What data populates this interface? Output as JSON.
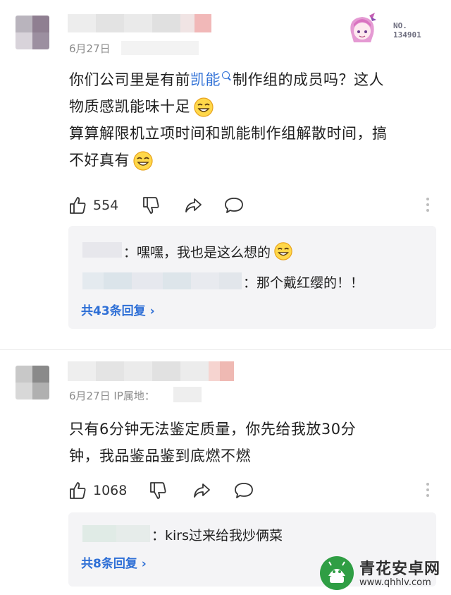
{
  "comments": [
    {
      "date": "6月27日",
      "badge_text": "NO.\n134901",
      "text_part1": "你们公司里是有前",
      "keyword": "凯能",
      "text_part2": "制作组的成员吗？这人",
      "text_line2": "物质感凯能味十足",
      "text_line3": "算算解限机立项时间和凯能制作组解散时间，搞",
      "text_line4": "不好真有",
      "likes": "554",
      "replies": [
        {
          "text": "：嘿嘿，我也是这么想的"
        },
        {
          "text": "：那个戴红缨的！！"
        }
      ],
      "more_replies": "共43条回复 ›"
    },
    {
      "date": "6月27日 IP属地：",
      "text_line1": "只有6分钟无法鉴定质量，你先给我放30分",
      "text_line2": "钟，我品鉴品鉴到底燃不燃",
      "likes": "1068",
      "replies": [
        {
          "text": "：kirs过来给我炒俩菜"
        }
      ],
      "more_replies": "共8条回复 ›"
    }
  ],
  "watermark": {
    "title": "青花安卓网",
    "url": "www.qhhlv.com"
  },
  "colors": {
    "link": "#2e6fd6",
    "reply_bg": "#f4f4f6",
    "text": "#1f1f1f",
    "muted": "#8c8c8c"
  }
}
